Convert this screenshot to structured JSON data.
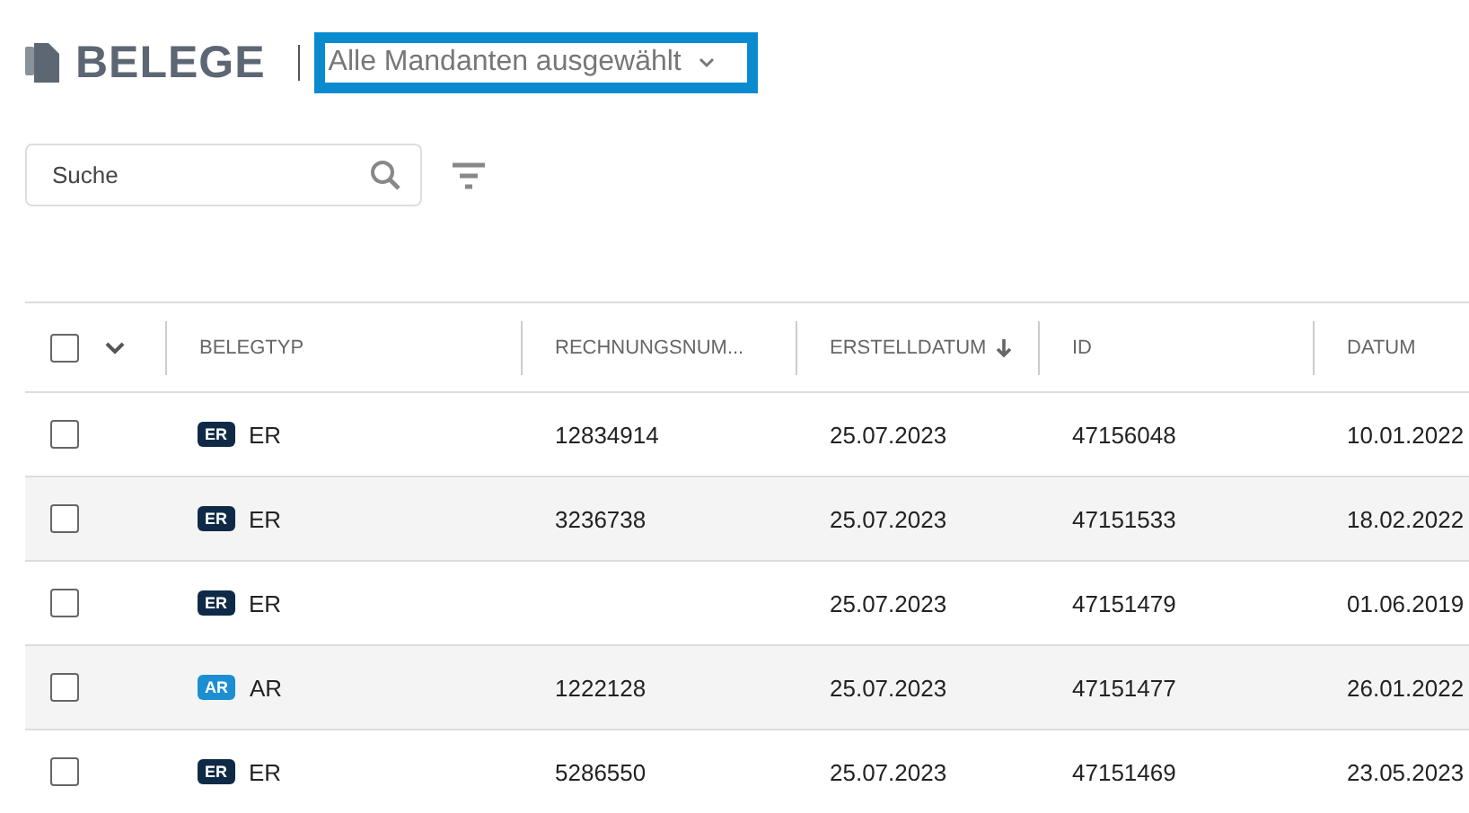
{
  "header": {
    "title": "BELEGE",
    "client_select": {
      "value": "Alle Mandanten ausgewählt",
      "focused": true
    }
  },
  "search": {
    "placeholder": "Suche"
  },
  "table": {
    "select_all": {
      "checked": false
    },
    "columns": [
      {
        "label": "BELEGTYP",
        "sorted": false
      },
      {
        "label": "RECHNUNGSNUM...",
        "sorted": false
      },
      {
        "label": "ERSTELLDATUM",
        "sorted": true
      },
      {
        "label": "ID",
        "sorted": false
      },
      {
        "label": "DATUM",
        "sorted": false
      }
    ],
    "rows": [
      {
        "checked": false,
        "badge": "ER",
        "color": "#0e2a47",
        "type": "ER",
        "invoice": "12834914",
        "created": "25.07.2023",
        "id": "47156048",
        "date": "10.01.2022"
      },
      {
        "checked": false,
        "badge": "ER",
        "color": "#0e2a47",
        "type": "ER",
        "invoice": "3236738",
        "created": "25.07.2023",
        "id": "47151533",
        "date": "18.02.2022"
      },
      {
        "checked": false,
        "badge": "ER",
        "color": "#0e2a47",
        "type": "ER",
        "created": "25.07.2023",
        "id": "47151479",
        "date": "01.06.2019"
      },
      {
        "checked": false,
        "badge": "AR",
        "color": "#1b8fd2",
        "type": "AR",
        "invoice": "1222128",
        "created": "25.07.2023",
        "id": "47151477",
        "date": "26.01.2022"
      },
      {
        "checked": false,
        "badge": "ER",
        "color": "#0e2a47",
        "type": "ER",
        "invoice": "5286550",
        "created": "25.07.2023",
        "id": "47151469",
        "date": "23.05.2023"
      }
    ]
  }
}
